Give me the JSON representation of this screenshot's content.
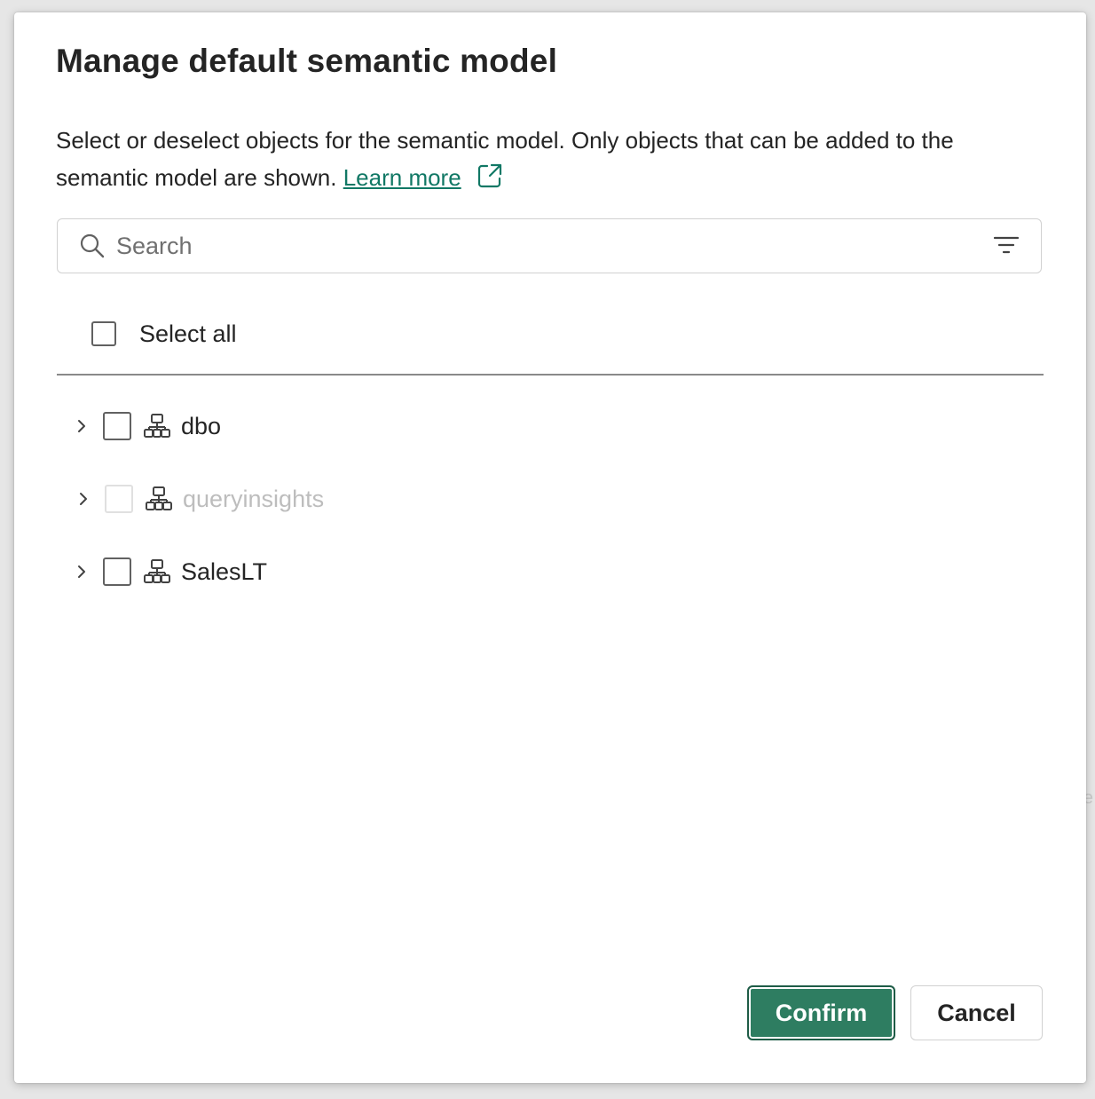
{
  "dialog": {
    "title": "Manage default semantic model",
    "description": "Select or deselect objects for the semantic model. Only objects that can be added to the semantic model are shown.",
    "learn_more_label": "Learn more",
    "search": {
      "placeholder": "Search",
      "value": ""
    },
    "select_all": {
      "label": "Select all",
      "checked": false
    },
    "schemas": [
      {
        "label": "dbo",
        "checked": false,
        "disabled": false,
        "icon": "schema-icon"
      },
      {
        "label": "queryinsights",
        "checked": false,
        "disabled": true,
        "icon": "schema-icon"
      },
      {
        "label": "SalesLT",
        "checked": false,
        "disabled": false,
        "icon": "schema-icon"
      }
    ],
    "buttons": {
      "confirm_label": "Confirm",
      "cancel_label": "Cancel"
    }
  },
  "background": {
    "peek_text": "e"
  },
  "colors": {
    "accent": "#2e7d61",
    "link": "#117865",
    "text": "#242424",
    "disabled_text": "#bdbdbd"
  },
  "icons": {
    "external_link": "open-in-new-icon",
    "search": "search-icon",
    "filter": "filter-icon",
    "expand": "chevron-right-icon"
  }
}
